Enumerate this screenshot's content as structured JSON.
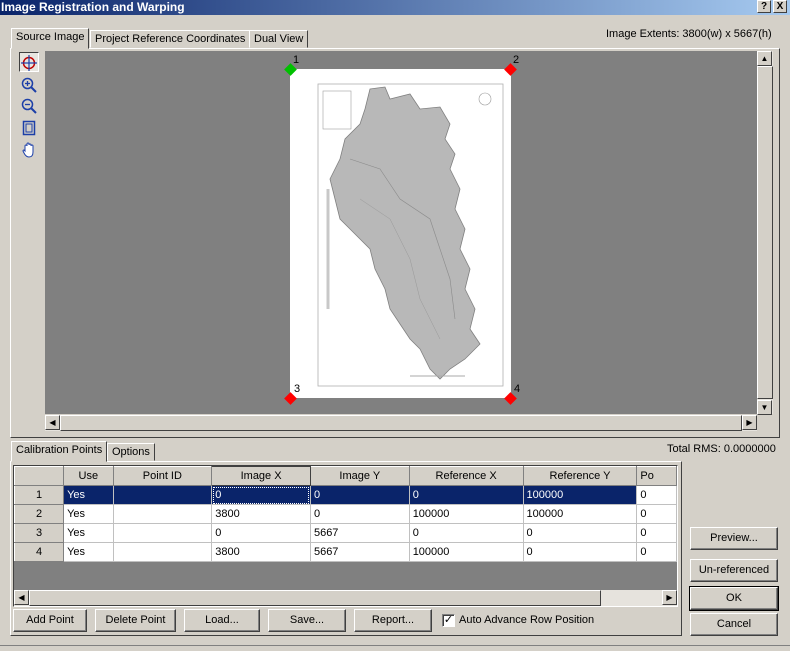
{
  "window": {
    "title": "Image Registration and Warping",
    "help_label": "?",
    "close_label": "X"
  },
  "top_tabs": [
    {
      "label": "Source Image",
      "active": true
    },
    {
      "label": "Project Reference Coordinates",
      "active": false
    },
    {
      "label": "Dual View",
      "active": false
    }
  ],
  "image_extents": "Image Extents: 3800(w) x 5667(h)",
  "tools": [
    {
      "name": "add-point-tool-icon",
      "glyph": "⊕",
      "active": true
    },
    {
      "name": "zoom-in-icon",
      "glyph": "🔍",
      "active": false
    },
    {
      "name": "zoom-out-icon",
      "glyph": "🔍",
      "active": false
    },
    {
      "name": "zoom-extent-icon",
      "glyph": "▢",
      "active": false
    },
    {
      "name": "pan-hand-icon",
      "glyph": "✋",
      "active": false
    }
  ],
  "markers": [
    {
      "label": "1",
      "color": "#00c000"
    },
    {
      "label": "2",
      "color": "#ff0000"
    },
    {
      "label": "3",
      "color": "#ff0000"
    },
    {
      "label": "4",
      "color": "#ff0000"
    }
  ],
  "bottom_tabs": [
    {
      "label": "Calibration Points",
      "active": true
    },
    {
      "label": "Options",
      "active": false
    }
  ],
  "total_rms": "Total RMS: 0.0000000",
  "grid": {
    "columns": [
      "Use",
      "Point ID",
      "Image X",
      "Image Y",
      "Reference X",
      "Reference Y",
      "Po"
    ],
    "rows": [
      {
        "num": "1",
        "use": "Yes",
        "point_id": "",
        "image_x": "0",
        "image_y": "0",
        "reference_x": "0",
        "reference_y": "100000",
        "po": "0"
      },
      {
        "num": "2",
        "use": "Yes",
        "point_id": "",
        "image_x": "3800",
        "image_y": "0",
        "reference_x": "100000",
        "reference_y": "100000",
        "po": "0"
      },
      {
        "num": "3",
        "use": "Yes",
        "point_id": "",
        "image_x": "0",
        "image_y": "5667",
        "reference_x": "0",
        "reference_y": "0",
        "po": "0"
      },
      {
        "num": "4",
        "use": "Yes",
        "point_id": "",
        "image_x": "3800",
        "image_y": "5667",
        "reference_x": "100000",
        "reference_y": "0",
        "po": "0"
      }
    ]
  },
  "buttons": {
    "add_point": "Add Point",
    "delete_point": "Delete Point",
    "load": "Load...",
    "save": "Save...",
    "report": "Report...",
    "preview": "Preview...",
    "unreferenced": "Un-referenced",
    "ok": "OK",
    "cancel": "Cancel"
  },
  "auto_advance": {
    "label": "Auto Advance Row Position",
    "checked": true
  },
  "colors": {
    "selection": "#0a246a",
    "titlebar": "#0a246a",
    "canvas": "#808080"
  }
}
